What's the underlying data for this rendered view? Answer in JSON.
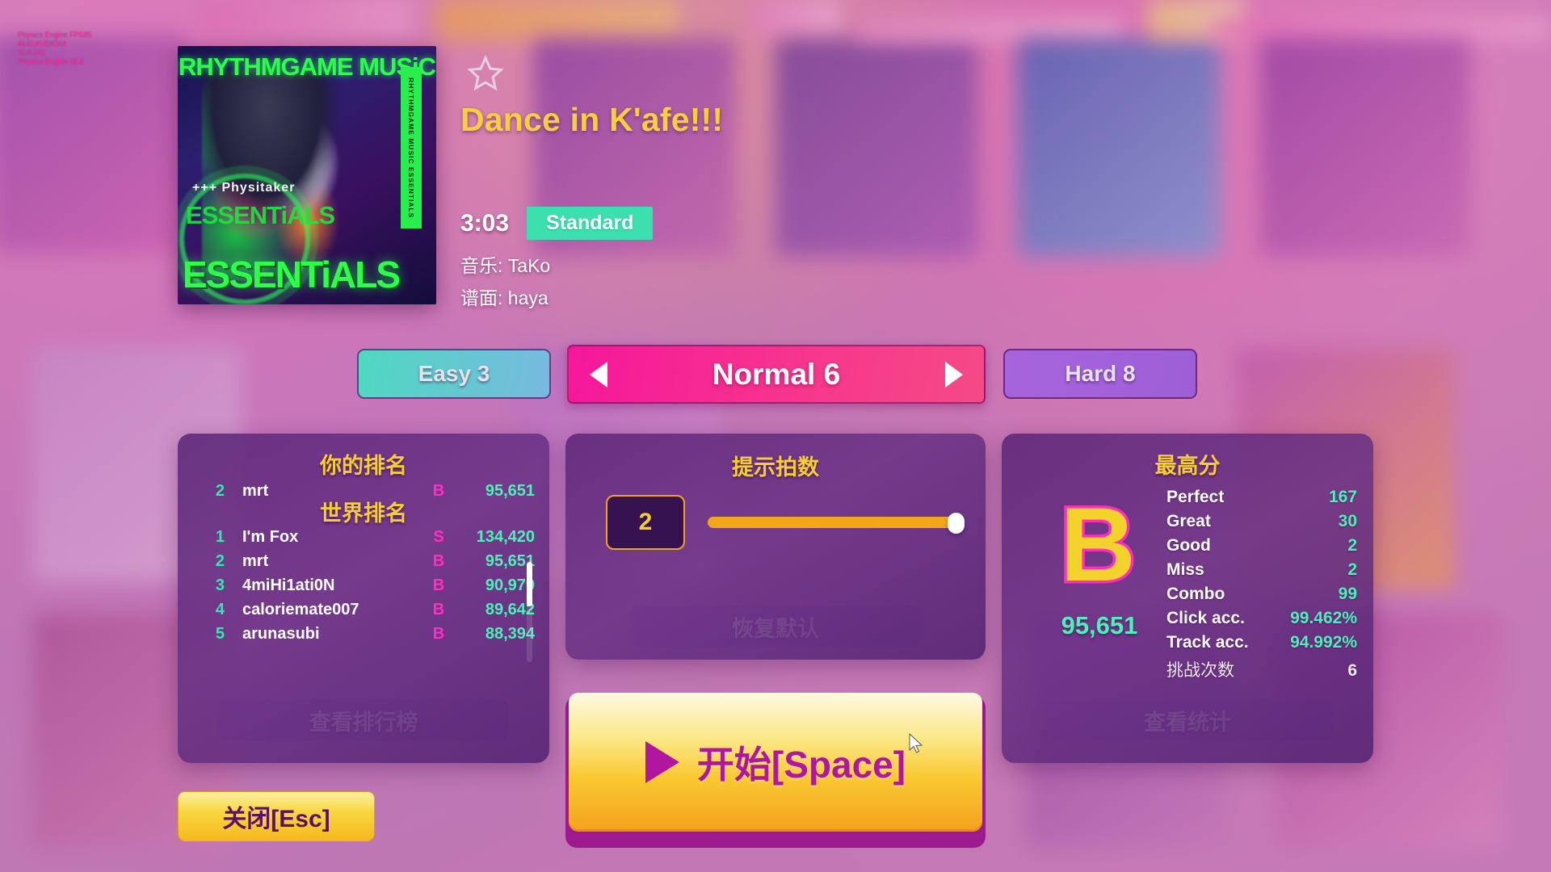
{
  "debug_overlay": "Physics Engine FPS85\nAUD:AUDIO44\n11.0.242\nPhysics Engine v3.2",
  "jacket": {
    "top_text": "RHYTHMGAME MUSiC",
    "side_text": "RHYTHMGAME MUSIC ESSENTIALS",
    "plus_text": "+++ Physitaker",
    "mid_text": "ESSENTiALS",
    "big_text": "ESSENTiALS"
  },
  "song": {
    "title": "Dance in K'afe!!!",
    "duration": "3:03",
    "mode_badge": "Standard",
    "music_credit": "音乐: TaKo",
    "chart_credit": "谱面: haya",
    "star_icon": "star-outline-icon"
  },
  "difficulty": {
    "easy_label": "Easy 3",
    "current_label": "Normal 6",
    "hard_label": "Hard 8",
    "prev_icon": "triangle-left-icon",
    "next_icon": "triangle-right-icon"
  },
  "leaderboard": {
    "your_rank_title": "你的排名",
    "world_rank_title": "世界排名",
    "your_rank": {
      "rank": "2",
      "name": "mrt",
      "grade": "B",
      "score": "95,651"
    },
    "world_rows": [
      {
        "rank": "1",
        "name": "I'm Fox",
        "grade": "S",
        "score": "134,420"
      },
      {
        "rank": "2",
        "name": "mrt",
        "grade": "B",
        "score": "95,651"
      },
      {
        "rank": "3",
        "name": "4miHi1ati0N",
        "grade": "B",
        "score": "90,979"
      },
      {
        "rank": "4",
        "name": "caloriemate007",
        "grade": "B",
        "score": "89,642"
      },
      {
        "rank": "5",
        "name": "arunasubi",
        "grade": "B",
        "score": "88,394"
      }
    ],
    "view_button": "查看排行榜"
  },
  "hint_beats": {
    "title": "提示拍数",
    "value": "2",
    "slider_percent": 100,
    "reset_button": "恢复默认"
  },
  "high_score": {
    "title": "最高分",
    "grade": "B",
    "score": "95,651",
    "stats": [
      {
        "label": "Perfect",
        "value": "167",
        "cn": false,
        "dim": false
      },
      {
        "label": "Great",
        "value": "30",
        "cn": false,
        "dim": false
      },
      {
        "label": "Good",
        "value": "2",
        "cn": false,
        "dim": false
      },
      {
        "label": "Miss",
        "value": "2",
        "cn": false,
        "dim": false
      },
      {
        "label": "Combo",
        "value": "99",
        "cn": false,
        "dim": false
      },
      {
        "label": "Click acc.",
        "value": "99.462%",
        "cn": false,
        "dim": false
      },
      {
        "label": "Track acc.",
        "value": "94.992%",
        "cn": false,
        "dim": false
      },
      {
        "label": "挑战次数",
        "value": "6",
        "cn": true,
        "dim": true
      }
    ],
    "view_button": "查看统计"
  },
  "actions": {
    "start_button": "开始[Space]",
    "start_icon": "play-triangle-icon",
    "close_button": "关闭[Esc]"
  },
  "colors": {
    "accent_pink": "#f5179b",
    "accent_yellow": "#f3d02e",
    "accent_green": "#4cf0b8",
    "grade_pink": "#ff2fc0",
    "panel_purple": "#5c2678",
    "slider_orange": "#f2a61c"
  }
}
